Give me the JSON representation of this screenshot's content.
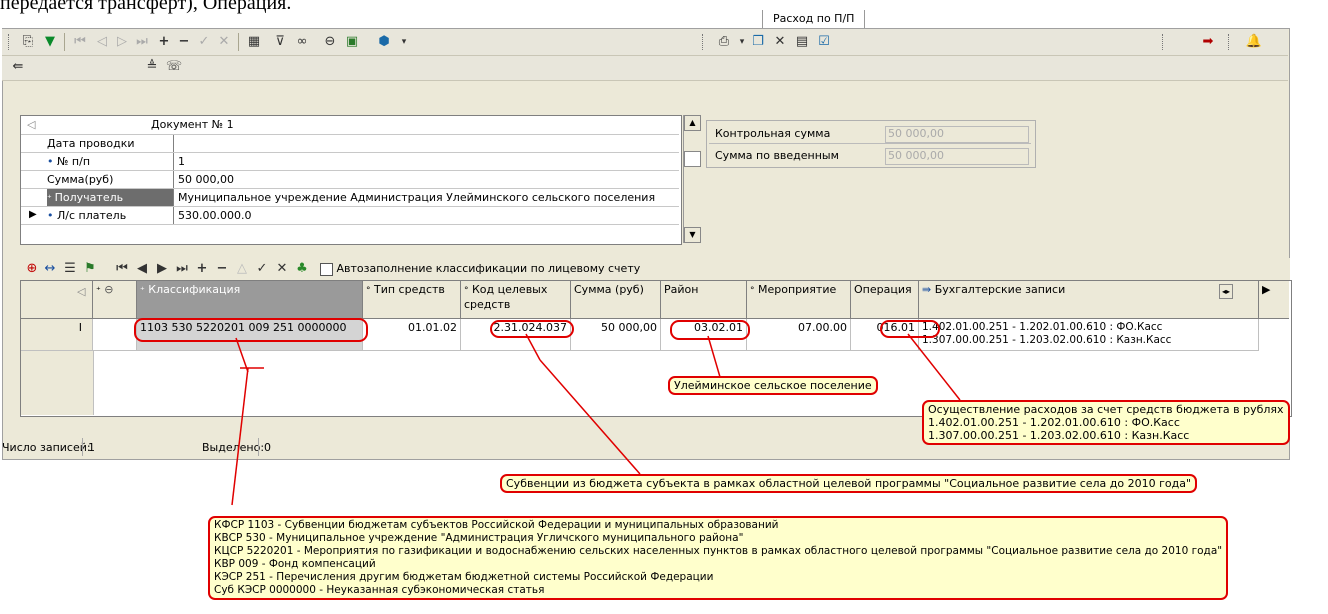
{
  "top_text": "передается трансферт), Операция.",
  "tab": {
    "label": "Расход по П/П"
  },
  "document": {
    "title": "Документ № 1",
    "rows": [
      {
        "name": "Дата проводки",
        "value": ""
      },
      {
        "name": "№ п/п",
        "value": "1"
      },
      {
        "name": "Сумма(руб)",
        "value": "50 000,00"
      },
      {
        "name": "Получатель",
        "value": "Муниципальное учреждение Администрация Улейминского сельского поселения"
      },
      {
        "name": "Л/с платель",
        "value": "530.00.000.0"
      }
    ]
  },
  "control_sums": [
    {
      "label": "Контрольная сумма",
      "value": "50 000,00"
    },
    {
      "label": "Сумма по введенным",
      "value": "50 000,00"
    }
  ],
  "grid_toolbar": {
    "autofill_label": "Автозаполнение классификации по лицевому счету"
  },
  "grid": {
    "headers": {
      "classification": "Классификация",
      "fund_type": "Тип средств",
      "target_code": "Код целевых средств",
      "sum": "Сумма (руб)",
      "region": "Район",
      "event": "Мероприятие",
      "operation": "Операция",
      "accounting": "Бухгалтерские записи"
    },
    "row": {
      "classification": "1103 530 5220201 009 251 0000000",
      "fund_type": "01.01.02",
      "target_code": "2.31.024.037",
      "sum": "50 000,00",
      "region": "03.02.01",
      "event": "07.00.00",
      "operation": "016.01",
      "accounting_1": "1.402.01.00.251 - 1.202.01.00.610 : ФО.Касс",
      "accounting_2": "1.307.00.00.251 - 1.203.02.00.610 : Казн.Касс"
    }
  },
  "status": {
    "records_label": "Число записей:",
    "records_value": "1",
    "selected_label": "Выделено:",
    "selected_value": "0"
  },
  "callouts": {
    "region": "Улейминское сельское поселение",
    "operation": [
      "Осуществление расходов за счет средств бюджета в рублях",
      "1.402.01.00.251 - 1.202.01.00.610 : ФО.Касс",
      "1.307.00.00.251 - 1.203.02.00.610 : Казн.Касс"
    ],
    "target": "Субвенции из бюджета субъекта в рамках областной  целевой программы \"Социальное развитие села до 2010 года\"",
    "classification": [
      "КФСР 1103 - Субвенции бюджетам субъектов Российской Федерации и муниципальных образований",
      "КВСР 530 - Муниципальное учреждение \"Администрация Угличского муниципального района\"",
      "КЦСР 5220201 - Мероприятия по газификации и водоснабжению сельских населенных пунктов в рамках областного целевой программы \"Социальное развитие села до 2010 года\"",
      "КВР 009 - Фонд компенсаций",
      "КЭСР 251 - Перечисления другим бюджетам бюджетной системы Российской Федерации",
      "Суб КЭСР 0000000 - Неуказанная субэкономическая статья"
    ]
  },
  "colors": {
    "callout_border": "#e00000",
    "callout_fill": "#ffffcc",
    "toolbar_bg": "#e8e6db"
  }
}
